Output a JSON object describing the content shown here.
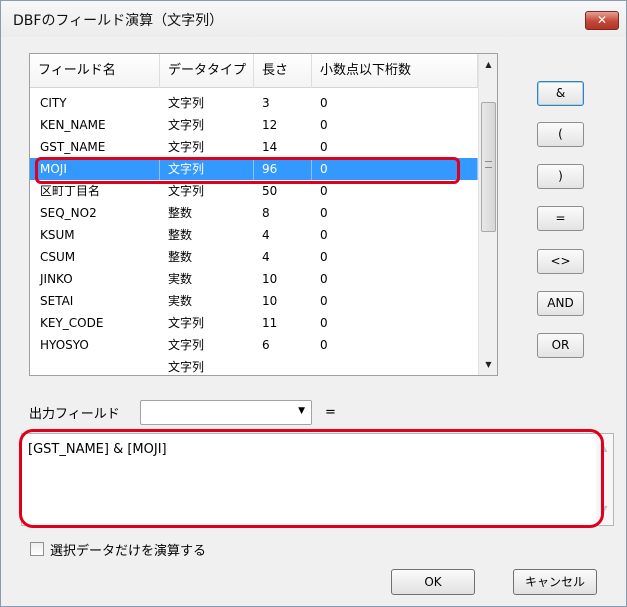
{
  "window": {
    "title": "DBFのフィールド演算（文字列）",
    "close_glyph": "✕"
  },
  "field_table": {
    "columns": [
      "フィールド名",
      "データタイプ",
      "長さ",
      "小数点以下桁数"
    ],
    "rows": [
      {
        "name": "CITY",
        "type": "文字列",
        "length": "3",
        "decimals": "0"
      },
      {
        "name": "KEN_NAME",
        "type": "文字列",
        "length": "12",
        "decimals": "0"
      },
      {
        "name": "GST_NAME",
        "type": "文字列",
        "length": "14",
        "decimals": "0"
      },
      {
        "name": "MOJI",
        "type": "文字列",
        "length": "96",
        "decimals": "0"
      },
      {
        "name": "区町丁目名",
        "type": "文字列",
        "length": "50",
        "decimals": "0"
      },
      {
        "name": "SEQ_NO2",
        "type": "整数",
        "length": "8",
        "decimals": "0"
      },
      {
        "name": "KSUM",
        "type": "整数",
        "length": "4",
        "decimals": "0"
      },
      {
        "name": "CSUM",
        "type": "整数",
        "length": "4",
        "decimals": "0"
      },
      {
        "name": "JINKO",
        "type": "実数",
        "length": "10",
        "decimals": "0"
      },
      {
        "name": "SETAI",
        "type": "実数",
        "length": "10",
        "decimals": "0"
      },
      {
        "name": "KEY_CODE",
        "type": "文字列",
        "length": "11",
        "decimals": "0"
      },
      {
        "name": "HYOSYO",
        "type": "文字列",
        "length": "6",
        "decimals": "0"
      },
      {
        "name": "",
        "type": "文字列",
        "length": "",
        "decimals": ""
      }
    ],
    "selected_index": 3
  },
  "operators": [
    "&",
    "(",
    ")",
    "=",
    "<>",
    "AND",
    "OR"
  ],
  "output": {
    "label": "出力フィールド",
    "selected_value": "",
    "equals": "="
  },
  "expression": "[GST_NAME] & [MOJI]",
  "checkbox_label": "選択データだけを演算する",
  "buttons": {
    "ok": "OK",
    "cancel": "キャンセル"
  },
  "colors": {
    "selection": "#3399ff",
    "highlight_outline": "#e0001b"
  }
}
